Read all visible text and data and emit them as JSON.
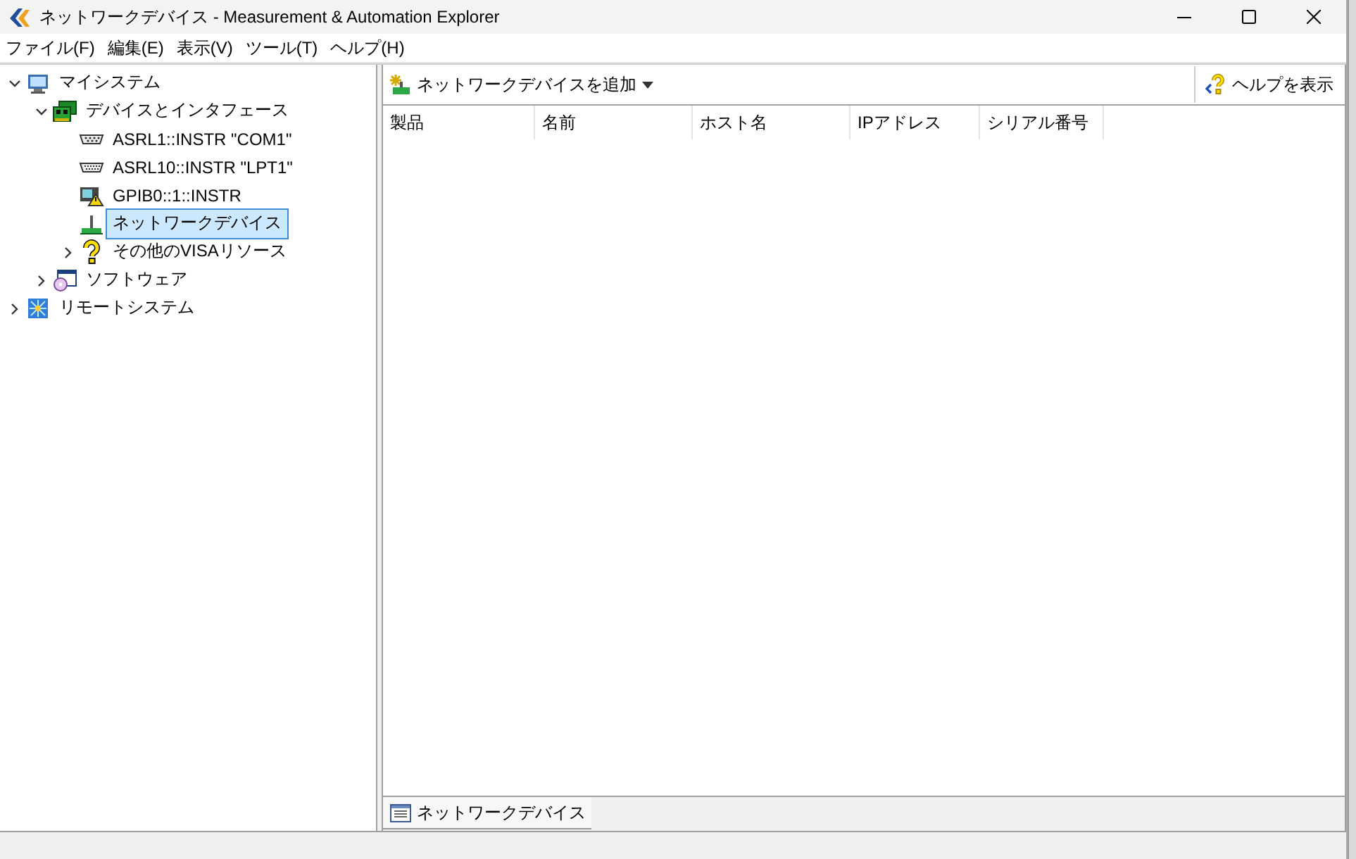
{
  "window": {
    "title": "ネットワークデバイス - Measurement & Automation Explorer"
  },
  "menu": [
    "ファイル(F)",
    "編集(E)",
    "表示(V)",
    "ツール(T)",
    "ヘルプ(H)"
  ],
  "tree": {
    "items": [
      {
        "label": "マイシステム",
        "kind": "monitor",
        "expanded": true,
        "selected": false,
        "children": [
          {
            "label": "デバイスとインタフェース",
            "kind": "cards",
            "expanded": true,
            "selected": false,
            "children": [
              {
                "label": "ASRL1::INSTR \"COM1\"",
                "kind": "serial",
                "selected": false
              },
              {
                "label": "ASRL10::INSTR \"LPT1\"",
                "kind": "parallel",
                "selected": false
              },
              {
                "label": "GPIB0::1::INSTR",
                "kind": "gpib",
                "selected": false
              },
              {
                "label": "ネットワークデバイス",
                "kind": "network",
                "selected": true
              },
              {
                "label": "その他のVISAリソース",
                "kind": "question",
                "expanded": false,
                "selected": false
              }
            ]
          },
          {
            "label": "ソフトウェア",
            "kind": "software",
            "expanded": false,
            "selected": false
          }
        ]
      },
      {
        "label": "リモートシステム",
        "kind": "remote",
        "expanded": false,
        "selected": false
      }
    ]
  },
  "toolbar": {
    "add_button": "ネットワークデバイスを追加",
    "help_button": "ヘルプを表示"
  },
  "table": {
    "columns": [
      "製品",
      "名前",
      "ホスト名",
      "IPアドレス",
      "シリアル番号"
    ]
  },
  "bottom_tabs": [
    {
      "label": "ネットワークデバイス",
      "selected": true
    }
  ]
}
